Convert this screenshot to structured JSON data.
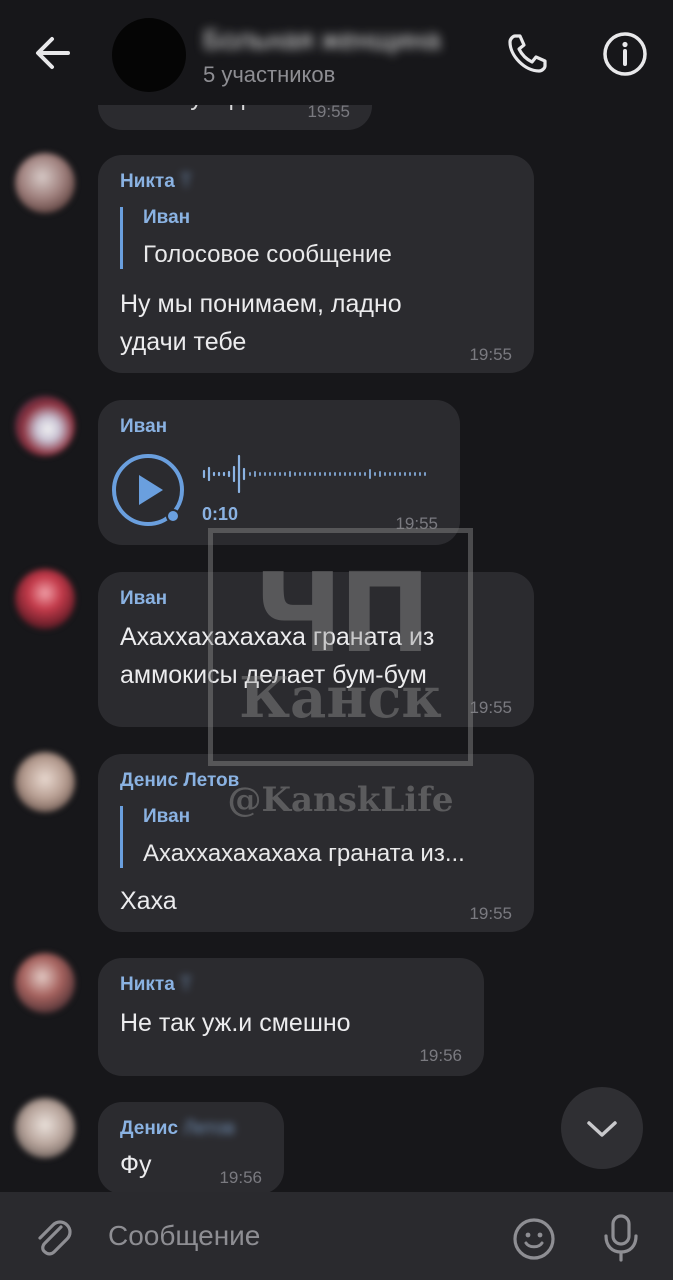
{
  "header": {
    "title": "Больная женщина",
    "subtitle": "5 участников"
  },
  "messages": [
    {
      "text_tail": "А не увидел",
      "time": "19:55"
    },
    {
      "sender_first": "Никта",
      "sender_last": "Т",
      "reply_name_first": "Иван",
      "reply_name_last": "",
      "reply_text": "Голосовое сообщение",
      "text_line1": "Ну мы понимаем, ладно",
      "text_line2": "удачи тебе",
      "time": "19:55"
    },
    {
      "sender_first": "Иван",
      "sender_last": "",
      "voice_duration": "0:10",
      "time": "19:55"
    },
    {
      "sender_first": "Иван",
      "sender_last": "",
      "text_line1": "Ахаххахахахаха граната из",
      "text_line2": "аммокисы делает бум-бум",
      "time": "19:55"
    },
    {
      "sender_first": "Денис Летов",
      "reply_name_first": "Иван",
      "reply_name_last": "",
      "reply_text": "Ахаххахахахаха граната из...",
      "text_line1": "Хаха",
      "time": "19:55"
    },
    {
      "sender_first": "Никта",
      "sender_last": "Т",
      "text_line1": "Не так уж.и смешно",
      "time": "19:56"
    },
    {
      "sender_first": "Денис",
      "sender_last": "Летов",
      "text_line1": "Фу",
      "time": "19:56"
    }
  ],
  "watermark": {
    "big": "ЧП",
    "mid": "Канск",
    "handle": "@KanskLife"
  },
  "input": {
    "placeholder": "Сообщение"
  },
  "colors": {
    "background": "#17171a",
    "bubble": "#2b2b2f",
    "accent": "#8ab2e2",
    "input_bar": "#2a2a2e"
  },
  "icons": [
    "back-arrow-icon",
    "phone-icon",
    "info-icon",
    "play-icon",
    "chevron-down-icon",
    "paperclip-icon",
    "smiley-icon",
    "microphone-icon"
  ]
}
